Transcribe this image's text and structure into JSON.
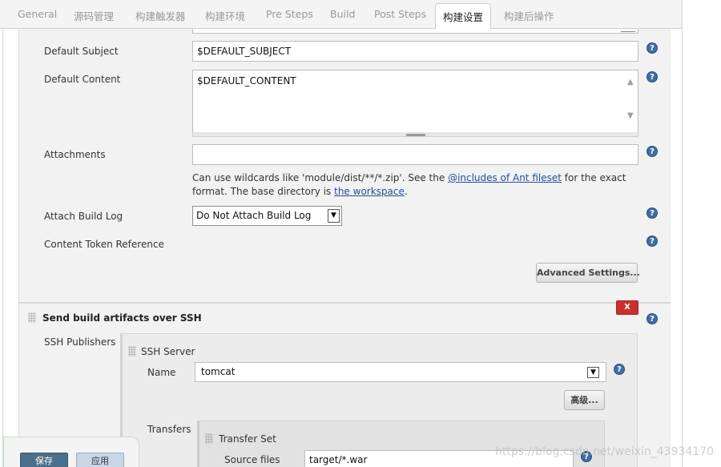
{
  "tabs": [
    {
      "label": "General"
    },
    {
      "label": "源码管理"
    },
    {
      "label": "构建触发器"
    },
    {
      "label": "构建环境"
    },
    {
      "label": "Pre Steps"
    },
    {
      "label": "Build"
    },
    {
      "label": "Post Steps"
    },
    {
      "label": "构建设置",
      "active": true
    },
    {
      "label": "构建后操作"
    }
  ],
  "email": {
    "subject_label": "Default Subject",
    "subject_value": "$DEFAULT_SUBJECT",
    "content_label": "Default Content",
    "content_value": "$DEFAULT_CONTENT",
    "attachments_label": "Attachments",
    "attachments_value": "",
    "hint_pre": "Can use wildcards like 'module/dist/**/*.zip'. See the ",
    "hint_link1": "@includes of Ant fileset",
    "hint_mid": " for the exact format. The base directory is ",
    "hint_link2": "the workspace",
    "hint_end": ".",
    "attach_log_label": "Attach Build Log",
    "attach_log_value": "Do Not Attach Build Log",
    "token_ref_label": "Content Token Reference",
    "advanced_settings_label": "Advanced Settings..."
  },
  "ssh": {
    "section_title": "Send build artifacts over SSH",
    "delete_label": "X",
    "publishers_label": "SSH Publishers",
    "server_title": "SSH Server",
    "name_label": "Name",
    "name_value": "tomcat",
    "advanced_label": "高级...",
    "transfers_label": "Transfers",
    "transfer_set_title": "Transfer Set",
    "source_files_label": "Source files",
    "source_files_value": "target/*.war"
  },
  "footer": {
    "save_label": "保存",
    "apply_label": "应用"
  },
  "watermark": "https://blog.csdn.net/weixin_43934170",
  "colors": {
    "help_icon": "#3f6da3",
    "delete_button": "#c9302c",
    "link": "#1f4f9b",
    "save_button": "#4b6e8a"
  }
}
